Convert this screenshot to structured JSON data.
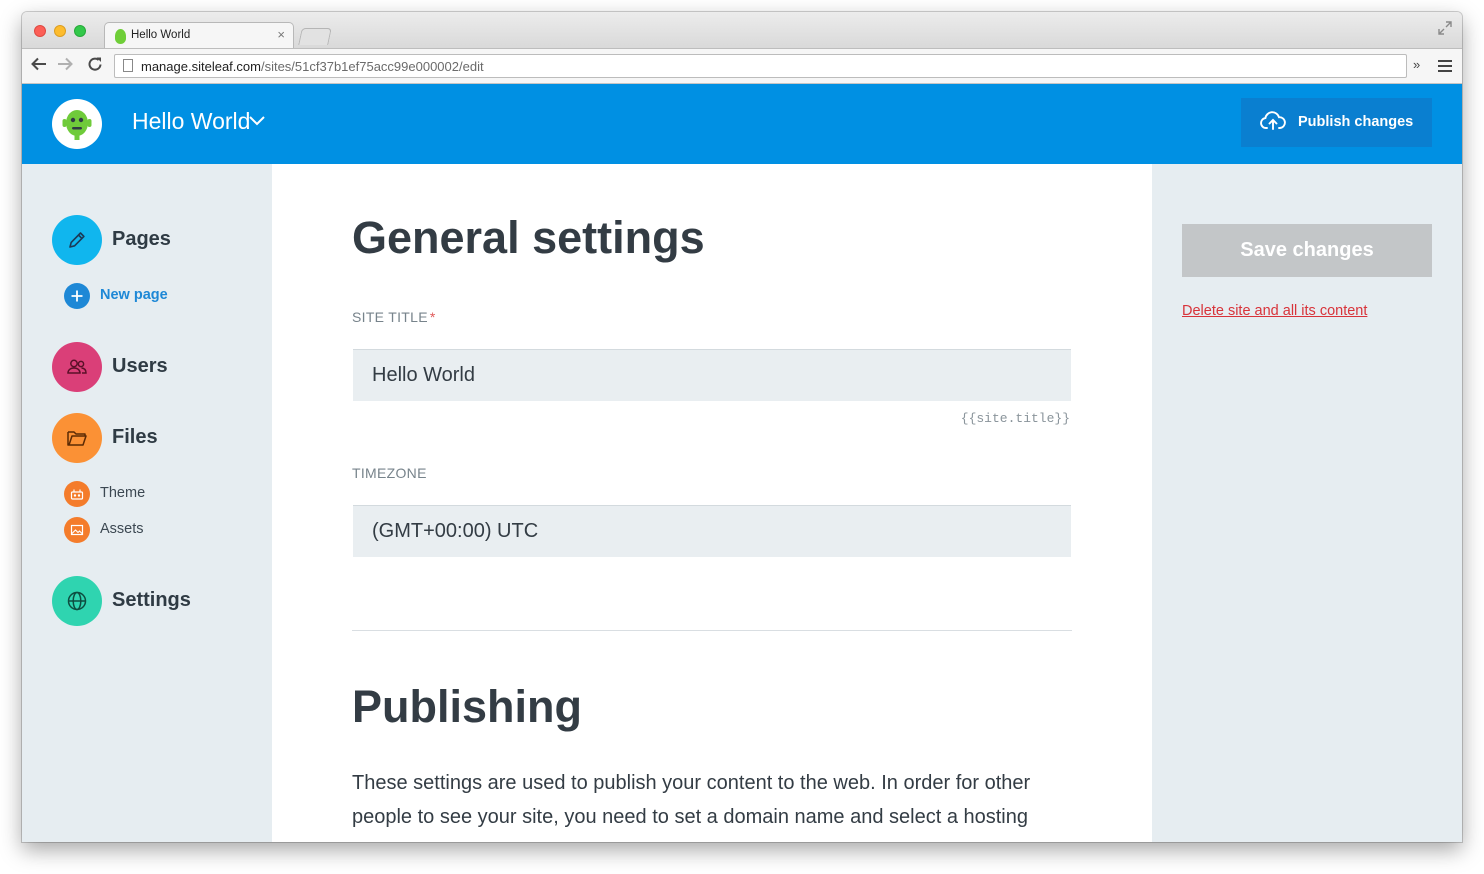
{
  "browser": {
    "tab_title": "Hello World",
    "tab_close": "×",
    "url_host": "manage.siteleaf.com",
    "url_path": "/sites/51cf37b1ef75acc99e000002/edit",
    "overflow": "»"
  },
  "header": {
    "site_name": "Hello World",
    "publish_label": "Publish changes",
    "accent_color": "#0090e3"
  },
  "sidebar": {
    "pages": {
      "label": "Pages",
      "icon": "pencil-icon",
      "color": "#10b6ee"
    },
    "new_page": {
      "label": "New page",
      "icon": "plus-icon",
      "color": "#1e88d6"
    },
    "users": {
      "label": "Users",
      "icon": "users-icon",
      "color": "#da3f78"
    },
    "files": {
      "label": "Files",
      "icon": "folder-icon",
      "color": "#fb9135"
    },
    "theme": {
      "label": "Theme",
      "icon": "theme-icon",
      "color": "#f47c2b"
    },
    "assets": {
      "label": "Assets",
      "icon": "image-icon",
      "color": "#f47c2b"
    },
    "settings": {
      "label": "Settings",
      "icon": "globe-icon",
      "color": "#2fd4b0"
    }
  },
  "main": {
    "general_heading": "General settings",
    "site_title_label": "SITE TITLE",
    "site_title_required": "*",
    "site_title_value": "Hello World",
    "site_title_hint": "{{site.title}}",
    "timezone_label": "TIMEZONE",
    "timezone_value": "(GMT+00:00) UTC",
    "publishing_heading": "Publishing",
    "publishing_text": "These settings are used to publish your content to the web. In order for other people to see your site, you need to set a domain name and select a hosting"
  },
  "right": {
    "save_label": "Save changes",
    "delete_label": "Delete site and all its content"
  }
}
